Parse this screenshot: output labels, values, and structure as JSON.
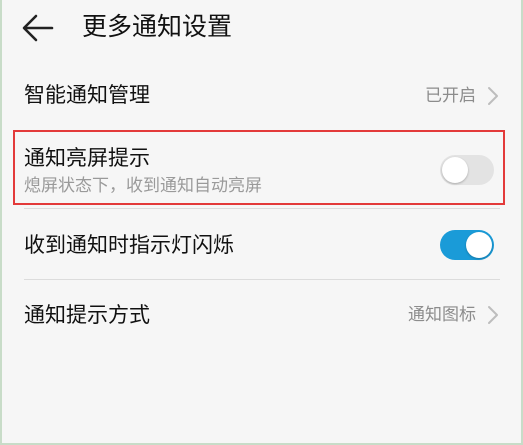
{
  "header": {
    "title": "更多通知设置",
    "back_icon": "back-arrow-icon"
  },
  "settings": {
    "smart_management": {
      "label": "智能通知管理",
      "value": "已开启"
    },
    "wake_screen": {
      "label": "通知亮屏提示",
      "description": "熄屏状态下，收到通知自动亮屏",
      "enabled": false
    },
    "indicator_light": {
      "label": "收到通知时指示灯闪烁",
      "enabled": true
    },
    "notification_style": {
      "label": "通知提示方式",
      "value": "通知图标"
    }
  },
  "colors": {
    "toggle_on": "#1a9bd8",
    "toggle_off": "#e3e3e3",
    "highlight": "#e33a3a"
  }
}
